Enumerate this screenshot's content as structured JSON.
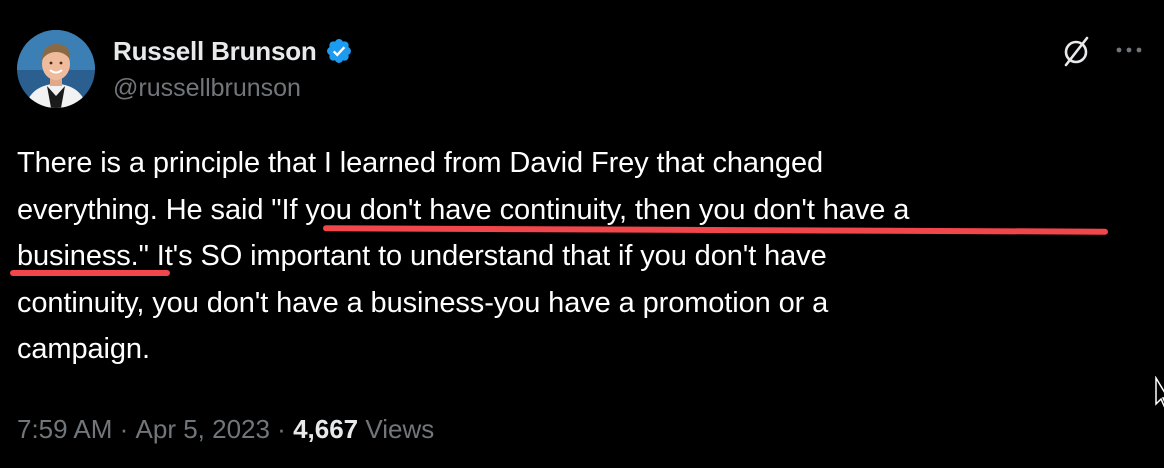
{
  "author": {
    "name": "Russell Brunson",
    "handle": "@russellbrunson",
    "verified_icon": "verified-badge-icon",
    "avatar_icon": "profile-photo-avatar"
  },
  "header_actions": {
    "grok_icon": "grok-slash-icon",
    "more_icon": "more-options-icon"
  },
  "body": {
    "line1": "There is a principle that I learned from David Frey that changed",
    "line2": "everything. He said \"If you don't have continuity, then you don't have a",
    "line3": "business.\" It's SO important to understand that if you don't have",
    "line4": "continuity, you don't have a business-you have a promotion or a",
    "line5": "campaign."
  },
  "annotation_color": "#f1464b",
  "meta": {
    "time": "7:59 AM",
    "separator1": " · ",
    "date": "Apr 5, 2023",
    "separator2": " · ",
    "views_count": "4,667",
    "views_label": " Views"
  },
  "colors": {
    "background": "#000000",
    "primary_text": "#ffffff",
    "secondary_text": "#71767b",
    "verified_blue": "#1d9bf0"
  }
}
